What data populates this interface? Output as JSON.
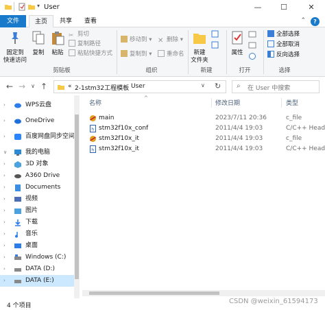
{
  "window": {
    "title": "User",
    "minimize": "—",
    "maximize": "☐",
    "close": "✕"
  },
  "tabs": [
    "文件",
    "主页",
    "共享",
    "查看"
  ],
  "ribbon": {
    "clipboard": {
      "pin": "固定到\n快速访问",
      "copy": "复制",
      "paste": "粘贴",
      "cut": "剪切",
      "copy_path": "复制路径",
      "paste_shortcut": "粘贴快捷方式",
      "label": "剪贴板"
    },
    "organize": {
      "move_to": "移动到",
      "copy_to": "复制到",
      "delete": "删除",
      "rename": "重命名",
      "label": "组织"
    },
    "new": {
      "new_folder": "新建\n文件夹",
      "label": "新建"
    },
    "open": {
      "properties": "属性",
      "label": "打开"
    },
    "select": {
      "select_all": "全部选择",
      "select_none": "全部取消",
      "invert": "反向选择",
      "label": "选择"
    }
  },
  "address": {
    "prefix": "«",
    "crumbs": [
      "2-1stm32工程模板",
      "User"
    ],
    "search_placeholder": "在 User 中搜索"
  },
  "nav": [
    {
      "label": "WPS云盘",
      "icon": "cloud-icon",
      "color": "#2b7de9"
    },
    {
      "label": "OneDrive",
      "icon": "onedrive-icon",
      "color": "#1e6fd9"
    },
    {
      "label": "百度网盘同步空间",
      "icon": "baidu-icon",
      "color": "#2a85ff"
    },
    {
      "label": "我的电脑",
      "icon": "computer-icon",
      "color": "#2b8ad6"
    },
    {
      "label": "3D 对象",
      "icon": "3d-objects-icon",
      "color": "#4aa3df"
    },
    {
      "label": "A360 Drive",
      "icon": "a360-icon",
      "color": "#555555"
    },
    {
      "label": "Documents",
      "icon": "documents-icon",
      "color": "#3b8ee0"
    },
    {
      "label": "视频",
      "icon": "video-icon",
      "color": "#4a6fb5"
    },
    {
      "label": "图片",
      "icon": "pictures-icon",
      "color": "#4aa3df"
    },
    {
      "label": "下载",
      "icon": "download-icon",
      "color": "#2b7de9"
    },
    {
      "label": "音乐",
      "icon": "music-icon",
      "color": "#2b7de9"
    },
    {
      "label": "桌面",
      "icon": "desktop-icon",
      "color": "#2b7de9"
    },
    {
      "label": "Windows (C:)",
      "icon": "drive-c-icon",
      "color": "#666666"
    },
    {
      "label": "DATA (D:)",
      "icon": "drive-d-icon",
      "color": "#666666"
    },
    {
      "label": "DATA (E:)",
      "icon": "drive-e-icon",
      "color": "#666666"
    }
  ],
  "columns": [
    "名称",
    "修改日期",
    "类型"
  ],
  "files": [
    {
      "name": "main",
      "date": "2023/7/11 20:36",
      "type": "c_file",
      "icon": "c-file-icon"
    },
    {
      "name": "stm32f10x_conf",
      "date": "2011/4/4 19:03",
      "type": "C/C++ Heade",
      "icon": "h-file-icon"
    },
    {
      "name": "stm32f10x_it",
      "date": "2011/4/4 19:03",
      "type": "c_file",
      "icon": "c-file-icon"
    },
    {
      "name": "stm32f10x_it",
      "date": "2011/4/4 19:03",
      "type": "C/C++ Heade",
      "icon": "h-file-icon"
    }
  ],
  "status": {
    "count": "4 个项目"
  },
  "watermark": "CSDN @weixin_61594173"
}
